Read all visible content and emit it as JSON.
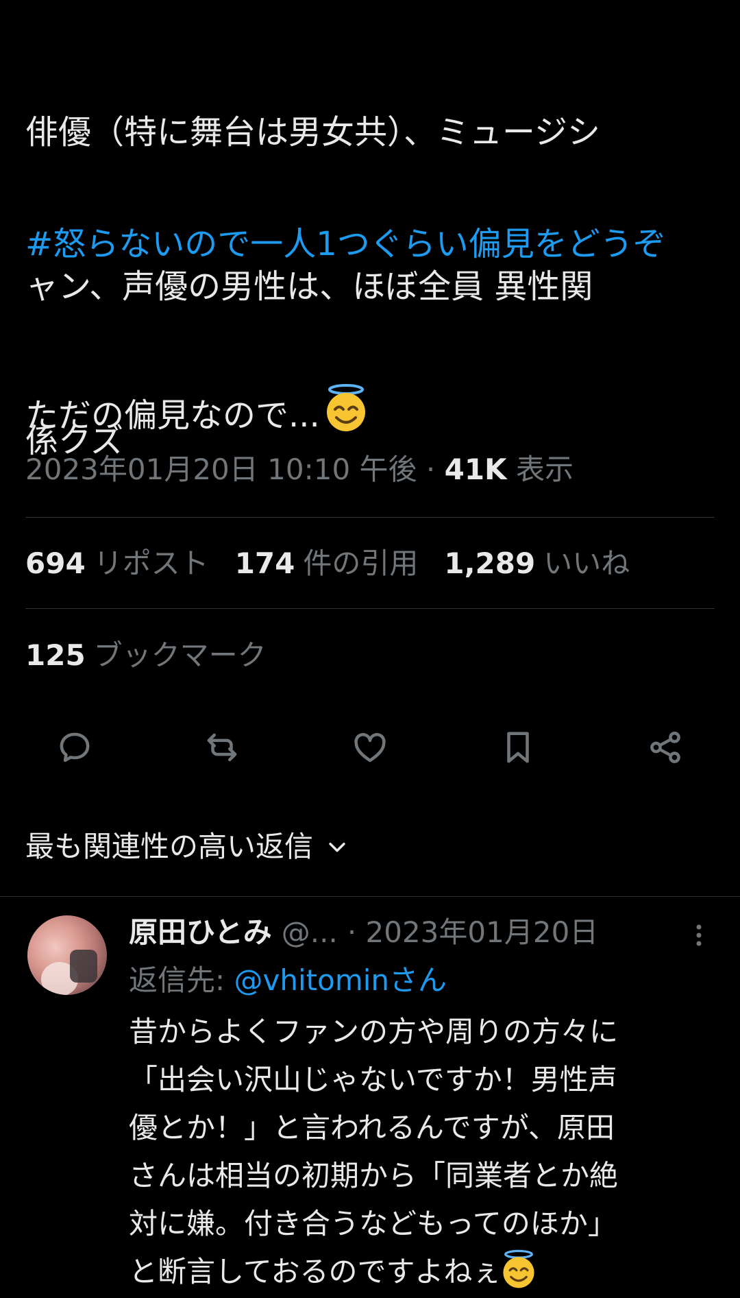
{
  "tweet": {
    "text_lines": [
      "俳優（特に舞台は男女共）、ミュージシ",
      "ャン、声優の男性は、ほぼ全員 異性関",
      "係クズ"
    ],
    "hashtag": "#怒らないので一人1つぐらい偏見をどうぞ",
    "closing_text": "ただの偏見なので...",
    "closing_emoji": "smiling-face-with-halo-icon",
    "timestamp": "2023年01月20日 10:10 午後",
    "separator": "·",
    "views_count": "41K",
    "views_label": "表示"
  },
  "stats": {
    "reposts_count": "694",
    "reposts_label": "リポスト",
    "quotes_count": "174",
    "quotes_label": "件の引用",
    "likes_count": "1,289",
    "likes_label": "いいね",
    "bookmarks_count": "125",
    "bookmarks_label": "ブックマーク"
  },
  "actions": [
    {
      "name": "reply-icon"
    },
    {
      "name": "repost-icon"
    },
    {
      "name": "like-icon"
    },
    {
      "name": "bookmark-icon"
    },
    {
      "name": "share-icon"
    }
  ],
  "sort": {
    "label": "最も関連性の高い返信",
    "icon": "chevron-down-icon"
  },
  "reply": {
    "name": "原田ひとみ",
    "handle": "@...",
    "date": "· 2023年01月20日",
    "reply_to_label": "返信先: ",
    "reply_to_mention": "@vhitominさん",
    "text_lines": [
      "昔からよくファンの方や周りの方々に",
      "「出会い沢山じゃないですか！男性声",
      "優とか！」と言われるんですが、原田",
      "さんは相当の初期から「同業者とか絶",
      "対に嫌。付き合うなどもってのほか」",
      "と断言しておるのですよねぇ"
    ],
    "trailing_emoji": "smiling-face-with-halo-icon"
  },
  "colors": {
    "background": "#000000",
    "text_primary": "#e7e9ea",
    "text_secondary": "#71767b",
    "accent": "#1d9bf0",
    "divider": "#2f3336"
  }
}
